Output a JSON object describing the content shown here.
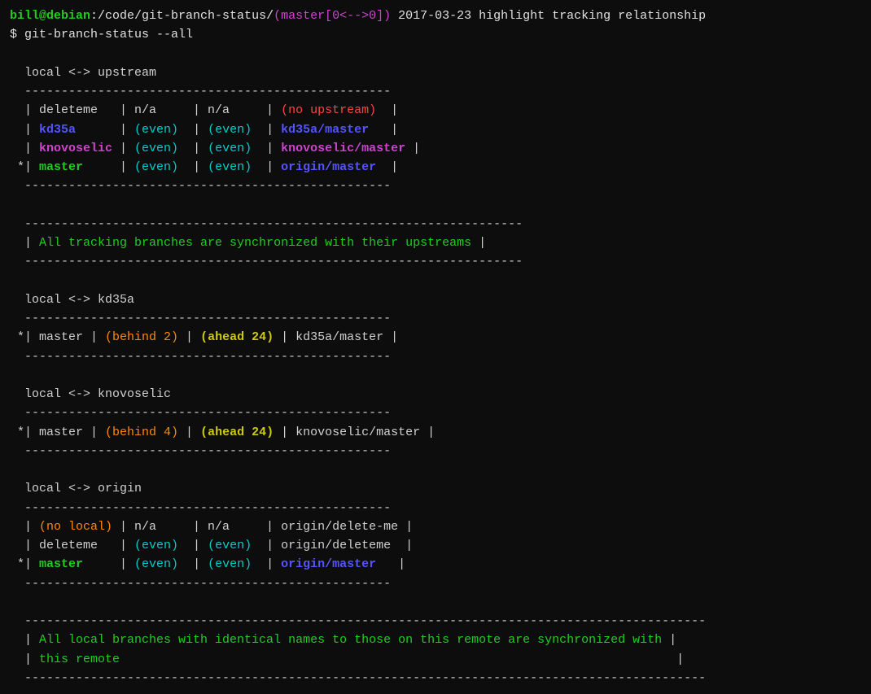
{
  "terminal": {
    "prompt": {
      "user_host": "bill@debian",
      "path": ":/code/git-branch-status/(master[0<-->0])",
      "date_cmd": " 2017-03-23 highlight tracking relationship",
      "cmd_line": "$ git-branch-status --all"
    },
    "sections": [
      {
        "id": "upstream",
        "header": "local <-> upstream",
        "divider": "----------------------------------------------------",
        "rows": [
          {
            "current": false,
            "name": "deleteme",
            "col1": "n/a",
            "col2": "n/a",
            "remote": "(no upstream)",
            "name_color": "white",
            "col1_color": "white",
            "col2_color": "white",
            "remote_color": "red"
          },
          {
            "current": false,
            "name": "kd35a",
            "col1": "(even)",
            "col2": "(even)",
            "remote": "kd35a/master",
            "name_color": "blue",
            "col1_color": "cyan",
            "col2_color": "cyan",
            "remote_color": "blue"
          },
          {
            "current": false,
            "name": "knovoselic",
            "col1": "(even)",
            "col2": "(even)",
            "remote": "knovoselic/master",
            "name_color": "magenta",
            "col1_color": "cyan",
            "col2_color": "cyan",
            "remote_color": "magenta"
          },
          {
            "current": true,
            "name": "master",
            "col1": "(even)",
            "col2": "(even)",
            "remote": "origin/master",
            "name_color": "green",
            "col1_color": "cyan",
            "col2_color": "cyan",
            "remote_color": "blue"
          }
        ],
        "summary_divider": "--------------------------------------------------------------------",
        "summary": "| All tracking branches are synchronized with their upstreams |",
        "summary_color": "green"
      },
      {
        "id": "kd35a",
        "header": "local <-> kd35a",
        "divider": "----------------------------------------------------",
        "rows": [
          {
            "current": true,
            "name": "master",
            "col1": "(behind 2)",
            "col2": "(ahead 24)",
            "remote": "kd35a/master",
            "name_color": "white",
            "col1_color": "orange",
            "col2_color": "yellow",
            "remote_color": "white"
          }
        ]
      },
      {
        "id": "knovoselic",
        "header": "local <-> knovoselic",
        "divider": "----------------------------------------------------",
        "rows": [
          {
            "current": true,
            "name": "master",
            "col1": "(behind 4)",
            "col2": "(ahead 24)",
            "remote": "knovoselic/master",
            "name_color": "white",
            "col1_color": "orange",
            "col2_color": "yellow",
            "remote_color": "white"
          }
        ]
      },
      {
        "id": "origin",
        "header": "local <-> origin",
        "divider": "----------------------------------------------------",
        "rows": [
          {
            "current": false,
            "name": "(no local)",
            "col1": "n/a",
            "col2": "n/a",
            "remote": "origin/delete-me",
            "name_color": "orange",
            "col1_color": "white",
            "col2_color": "white",
            "remote_color": "white"
          },
          {
            "current": false,
            "name": "deleteme",
            "col1": "(even)",
            "col2": "(even)",
            "remote": "origin/deleteme",
            "name_color": "white",
            "col1_color": "cyan",
            "col2_color": "cyan",
            "remote_color": "white"
          },
          {
            "current": true,
            "name": "master",
            "col1": "(even)",
            "col2": "(even)",
            "remote": "origin/master",
            "name_color": "green",
            "col1_color": "cyan",
            "col2_color": "cyan",
            "remote_color": "blue"
          }
        ],
        "summary_divider": "---------------------------------------------------------------------------------------------",
        "summary_line1": "| All local branches with identical names to those on this remote are synchronized with |",
        "summary_line2": "| this remote                                                                            |",
        "summary_color": "green"
      }
    ]
  }
}
